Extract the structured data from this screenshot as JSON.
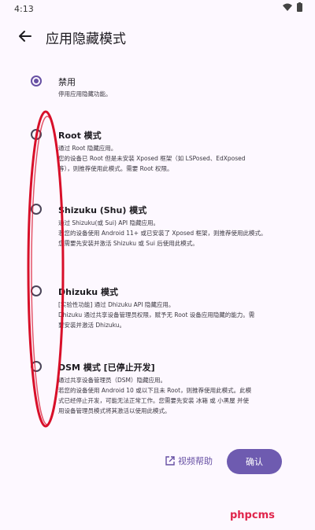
{
  "status": {
    "time": "4:13"
  },
  "header": {
    "title": "应用隐藏模式"
  },
  "options": [
    {
      "title": "禁用",
      "lines": [
        "停用应用隐藏功能。"
      ],
      "selected": true
    },
    {
      "title": "Root 模式",
      "lines": [
        "通过 Root 隐藏应用。",
        "您的设备已 Root 但是未安装 Xposed 框架（如 LSPosed、EdXposed",
        "等），则推荐使用此模式。需要 Root 权限。"
      ],
      "selected": false
    },
    {
      "title": "Shizuku (Shu) 模式",
      "lines": [
        "通过 Shizuku(或 Sui) API 隐藏应用。",
        "若您的设备使用 Android 11+ 或已安装了 Xposed 框架，则推荐使用此模式。",
        "您需要先安装并激活 Shizuku 或 Sui 后使用此模式。"
      ],
      "selected": false
    },
    {
      "title": "Dhizuku 模式",
      "lines": [
        "[实验性功能] 通过 Dhizuku API 隐藏应用。",
        "Dhizuku 通过共享设备管理员权限，赋予无 Root 设备应用隐藏的能力。需",
        "要安装并激活 Dhizuku。"
      ],
      "selected": false
    },
    {
      "title": "DSM 模式 [已停止开发]",
      "lines": [
        "通过共享设备管理员（DSM）隐藏应用。",
        "若您的设备使用 Android 10 或以下且未 Root，则推荐使用此模式。此模",
        "式已经停止开发，可能无法正常工作。您需要先安装 冰箱 或 小黑屋 并使",
        "用设备管理员模式将其激活以使用此模式。"
      ],
      "selected": false
    }
  ],
  "footer": {
    "help_label": "视频帮助",
    "confirm_label": "确认"
  },
  "watermark": "phpcms",
  "colors": {
    "accent": "#6750a4",
    "annotation": "#d8102a",
    "watermark": "#e0244a"
  }
}
